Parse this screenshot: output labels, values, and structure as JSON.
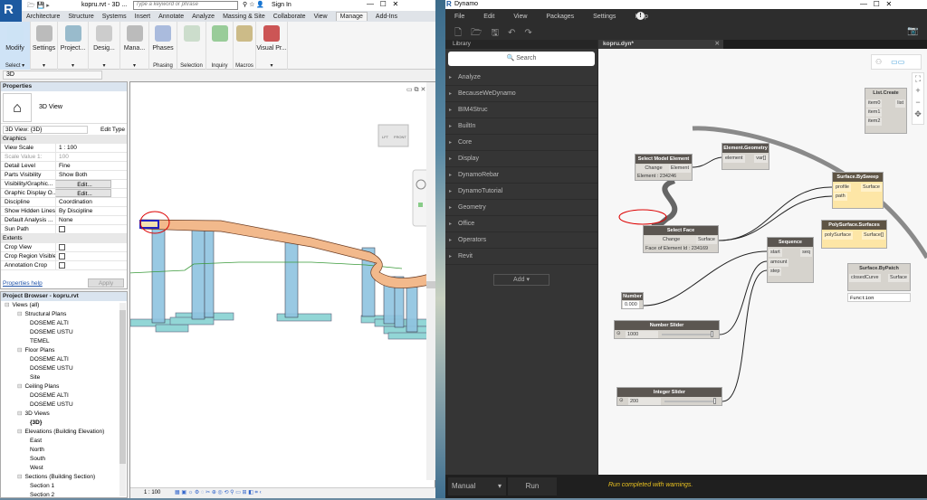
{
  "revit": {
    "logo": "R",
    "title": "kopru.rvt - 3D ...",
    "search_placeholder": "Type a keyword or phrase",
    "sign_in": "Sign In",
    "tabs": [
      "Architecture",
      "Structure",
      "Systems",
      "Insert",
      "Annotate",
      "Analyze",
      "Massing & Site",
      "Collaborate",
      "View",
      "Manage",
      "Add-Ins"
    ],
    "active_tab": "Manage",
    "ribbon": [
      {
        "label": "Modify",
        "sub": "Select ▾"
      },
      {
        "label": "Settings",
        "sub": "▾"
      },
      {
        "label": "Project...",
        "sub": "▾"
      },
      {
        "label": "Desig...",
        "sub": "▾"
      },
      {
        "label": "Mana...",
        "sub": "▾"
      },
      {
        "label": "Phases",
        "sub": "Phasing"
      },
      {
        "label": "",
        "sub": "Selection"
      },
      {
        "label": "",
        "sub": "Inquiry"
      },
      {
        "label": "",
        "sub": "Macros"
      },
      {
        "label": "Visual Pr...",
        "sub": "▾"
      }
    ],
    "type_selector": "3D",
    "properties": {
      "title": "Properties",
      "type_name": "3D View",
      "instance": "3D View: {3D}",
      "edit_type": "Edit Type",
      "groups": [
        {
          "name": "Graphics",
          "rows": [
            [
              "View Scale",
              "1 : 100"
            ],
            [
              "Scale Value    1:",
              "100"
            ],
            [
              "Detail Level",
              "Fine"
            ],
            [
              "Parts Visibility",
              "Show Both"
            ],
            [
              "Visibility/Graphic...",
              "Edit..."
            ],
            [
              "Graphic Display O...",
              "Edit..."
            ],
            [
              "Discipline",
              "Coordination"
            ],
            [
              "Show Hidden Lines",
              "By Discipline"
            ],
            [
              "Default Analysis ...",
              "None"
            ],
            [
              "Sun Path",
              ""
            ]
          ]
        },
        {
          "name": "Extents",
          "rows": [
            [
              "Crop View",
              ""
            ],
            [
              "Crop Region Visible",
              ""
            ],
            [
              "Annotation Crop",
              ""
            ]
          ]
        }
      ],
      "help": "Properties help",
      "apply": "Apply"
    },
    "browser": {
      "title": "Project Browser - kopru.rvt",
      "tree": [
        {
          "level": 0,
          "text": "Views (all)"
        },
        {
          "level": 1,
          "text": "Structural Plans"
        },
        {
          "level": 2,
          "text": "DOSEME ALTI"
        },
        {
          "level": 2,
          "text": "DOSEME USTU"
        },
        {
          "level": 2,
          "text": "TEMEL"
        },
        {
          "level": 1,
          "text": "Floor Plans"
        },
        {
          "level": 2,
          "text": "DOSEME ALTI"
        },
        {
          "level": 2,
          "text": "DOSEME USTU"
        },
        {
          "level": 2,
          "text": "Site"
        },
        {
          "level": 1,
          "text": "Ceiling Plans"
        },
        {
          "level": 2,
          "text": "DOSEME ALTI"
        },
        {
          "level": 2,
          "text": "DOSEME USTU"
        },
        {
          "level": 1,
          "text": "3D Views"
        },
        {
          "level": 2,
          "text": "{3D}"
        },
        {
          "level": 1,
          "text": "Elevations (Building Elevation)"
        },
        {
          "level": 2,
          "text": "East"
        },
        {
          "level": 2,
          "text": "North"
        },
        {
          "level": 2,
          "text": "South"
        },
        {
          "level": 2,
          "text": "West"
        },
        {
          "level": 1,
          "text": "Sections (Building Section)"
        },
        {
          "level": 2,
          "text": "Section 1"
        },
        {
          "level": 2,
          "text": "Section 2"
        }
      ]
    },
    "view": {
      "scale": "1 : 100",
      "cube_left": "LFT",
      "cube_front": "FRONT"
    }
  },
  "dynamo": {
    "title": "Dynamo",
    "menu": [
      "File",
      "Edit",
      "View",
      "Packages",
      "Settings",
      "Help"
    ],
    "library_title": "Library",
    "search_placeholder": "Search",
    "library_items": [
      "Analyze",
      "BecauseWeDynamo",
      "BIM4Struc",
      "BuiltIn",
      "Core",
      "Display",
      "DynamoRebar",
      "DynamoTutorial",
      "Geometry",
      "Office",
      "Operators",
      "Revit"
    ],
    "add_label": "Add",
    "tab": "kopru.dyn*",
    "nodes": {
      "select_model": {
        "title": "Select Model Element",
        "button": "Change",
        "out": "Element",
        "info": "Element : 234246"
      },
      "element_geometry": {
        "title": "Element.Geometry",
        "in": "element",
        "out": "var[]"
      },
      "sweep": {
        "title": "Surface.BySweep",
        "in1": "profile",
        "in2": "path",
        "out": "Surface"
      },
      "polysurface": {
        "title": "PolySurface.Surfaces",
        "in": "polySurface",
        "out": "Surface[]"
      },
      "select_face": {
        "title": "Select Face",
        "button": "Change",
        "out": "Surface",
        "info": "Face of Element Id : 234169"
      },
      "sequence": {
        "title": "Sequence",
        "in1": "start",
        "in2": "amount",
        "in3": "step",
        "out": "seq"
      },
      "bypatch": {
        "title": "Surface.ByPatch",
        "in": "closedCurve",
        "out": "Surface",
        "func": "Function"
      },
      "list_create": {
        "title": "List.Create",
        "in0": "item0",
        "in1": "item1",
        "in2": "item2",
        "out": "list"
      },
      "number": {
        "title": "Number",
        "value": "0.000"
      },
      "number_slider": {
        "title": "Number Slider",
        "value": "1000"
      },
      "integer_slider": {
        "title": "Integer Slider",
        "value": "200"
      }
    },
    "run_mode": "Manual",
    "run": "Run",
    "status": "Run completed with warnings.",
    "status_color": "#e8c020"
  }
}
